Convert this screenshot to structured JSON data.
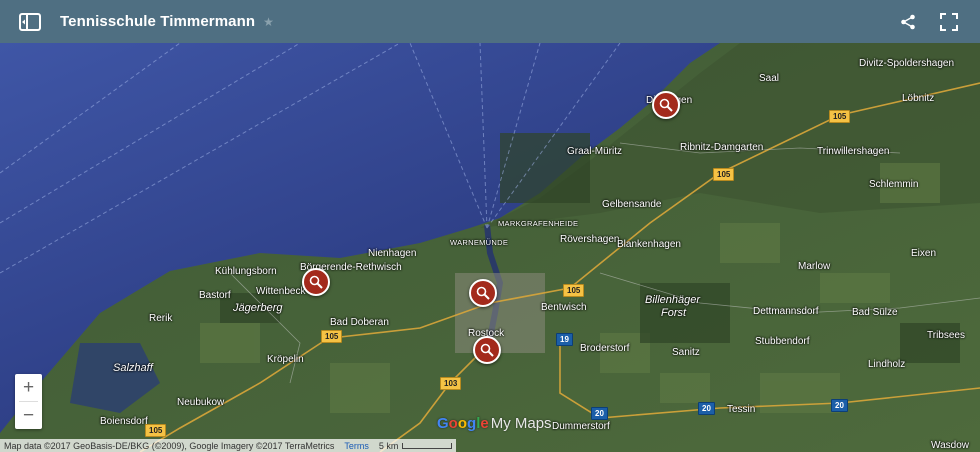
{
  "header": {
    "title": "Tennisschule Timmermann"
  },
  "map": {
    "places": [
      {
        "name": "Saal",
        "cls": "",
        "pos": "left:759px;top:31px"
      },
      {
        "name": "Divitz-Spoldershagen",
        "cls": "",
        "pos": "left:859px;top:16px"
      },
      {
        "name": "Löbnitz",
        "cls": "",
        "pos": "left:902px;top:51px"
      },
      {
        "name": "Dierhagen",
        "cls": "",
        "pos": "left:646px;top:53px"
      },
      {
        "name": "Graal-Müritz",
        "cls": "",
        "pos": "left:567px;top:104px"
      },
      {
        "name": "Ribnitz-Damgarten",
        "cls": "",
        "pos": "left:680px;top:100px"
      },
      {
        "name": "Trinwillershagen",
        "cls": "",
        "pos": "left:817px;top:104px"
      },
      {
        "name": "Schlemmin",
        "cls": "",
        "pos": "left:869px;top:137px"
      },
      {
        "name": "Gelbensande",
        "cls": "",
        "pos": "left:602px;top:157px"
      },
      {
        "name": "MARKGRAFENHEIDE",
        "cls": "small",
        "pos": "left:498px;top:177px"
      },
      {
        "name": "Rövershagen",
        "cls": "",
        "pos": "left:560px;top:192px"
      },
      {
        "name": "Blankenhagen",
        "cls": "",
        "pos": "left:617px;top:197px"
      },
      {
        "name": "WARNEMÜNDE",
        "cls": "small",
        "pos": "left:450px;top:196px"
      },
      {
        "name": "Nienhagen",
        "cls": "",
        "pos": "left:368px;top:206px"
      },
      {
        "name": "Eixen",
        "cls": "",
        "pos": "left:911px;top:206px"
      },
      {
        "name": "Kühlungsborn",
        "cls": "",
        "pos": "left:215px;top:224px"
      },
      {
        "name": "Börgerende-Rethwisch",
        "cls": "",
        "pos": "left:300px;top:220px"
      },
      {
        "name": "Marlow",
        "cls": "",
        "pos": "left:798px;top:219px"
      },
      {
        "name": "Wittenbeck",
        "cls": "",
        "pos": "left:256px;top:244px"
      },
      {
        "name": "Bastorf",
        "cls": "",
        "pos": "left:199px;top:248px"
      },
      {
        "name": "Bentwisch",
        "cls": "",
        "pos": "left:541px;top:260px"
      },
      {
        "name": "Billenhäger",
        "cls": "italic",
        "pos": "left:645px;top:252px"
      },
      {
        "name": "Forst",
        "cls": "italic",
        "pos": "left:661px;top:265px"
      },
      {
        "name": "Jägerberg",
        "cls": "italic",
        "pos": "left:233px;top:260px"
      },
      {
        "name": "Dettmannsdorf",
        "cls": "",
        "pos": "left:753px;top:264px"
      },
      {
        "name": "Bad Sülze",
        "cls": "",
        "pos": "left:852px;top:265px"
      },
      {
        "name": "Rerik",
        "cls": "",
        "pos": "left:149px;top:271px"
      },
      {
        "name": "Bad Doberan",
        "cls": "",
        "pos": "left:330px;top:275px"
      },
      {
        "name": "Rostock",
        "cls": "",
        "pos": "left:468px;top:286px"
      },
      {
        "name": "Stubbendorf",
        "cls": "",
        "pos": "left:755px;top:294px"
      },
      {
        "name": "Tribsees",
        "cls": "",
        "pos": "left:927px;top:288px"
      },
      {
        "name": "Broderstorf",
        "cls": "",
        "pos": "left:580px;top:301px"
      },
      {
        "name": "Sanitz",
        "cls": "",
        "pos": "left:672px;top:305px"
      },
      {
        "name": "Kröpelin",
        "cls": "",
        "pos": "left:267px;top:312px"
      },
      {
        "name": "Salzhaff",
        "cls": "italic",
        "pos": "left:113px;top:320px"
      },
      {
        "name": "Lindholz",
        "cls": "",
        "pos": "left:868px;top:317px"
      },
      {
        "name": "Neubukow",
        "cls": "",
        "pos": "left:177px;top:355px"
      },
      {
        "name": "Tessin",
        "cls": "",
        "pos": "left:727px;top:362px"
      },
      {
        "name": "Boiensdorf",
        "cls": "",
        "pos": "left:100px;top:374px"
      },
      {
        "name": "Dummerstorf",
        "cls": "",
        "pos": "left:552px;top:379px"
      },
      {
        "name": "Wasdow",
        "cls": "",
        "pos": "left:931px;top:398px"
      }
    ],
    "shields": [
      {
        "label": "105",
        "cls": "",
        "pos": "left:829px;top:67px"
      },
      {
        "label": "105",
        "cls": "",
        "pos": "left:713px;top:125px"
      },
      {
        "label": "105",
        "cls": "",
        "pos": "left:563px;top:241px"
      },
      {
        "label": "105",
        "cls": "",
        "pos": "left:321px;top:287px"
      },
      {
        "label": "19",
        "cls": "blue",
        "pos": "left:556px;top:290px"
      },
      {
        "label": "103",
        "cls": "",
        "pos": "left:440px;top:334px"
      },
      {
        "label": "20",
        "cls": "blue",
        "pos": "left:591px;top:364px"
      },
      {
        "label": "20",
        "cls": "blue",
        "pos": "left:698px;top:359px"
      },
      {
        "label": "20",
        "cls": "blue",
        "pos": "left:831px;top:356px"
      },
      {
        "label": "105",
        "cls": "",
        "pos": "left:145px;top:381px"
      }
    ],
    "markers": [
      {
        "name": "marker-dierhagen",
        "pos": "left:652px;top:48px"
      },
      {
        "name": "marker-boergerende",
        "pos": "left:302px;top:225px"
      },
      {
        "name": "marker-rostock-north",
        "pos": "left:469px;top:236px"
      },
      {
        "name": "marker-rostock-south",
        "pos": "left:473px;top:293px"
      }
    ]
  },
  "zoom": {
    "in": "+",
    "out": "−"
  },
  "attribution": {
    "text": "Map data ©2017 GeoBasis-DE/BKG (©2009), Google Imagery ©2017 TerraMetrics",
    "terms": "Terms",
    "scale": "5 km"
  },
  "logo": {
    "g": [
      "G",
      "o",
      "o",
      "g",
      "l",
      "e"
    ],
    "mymaps": "My Maps"
  }
}
